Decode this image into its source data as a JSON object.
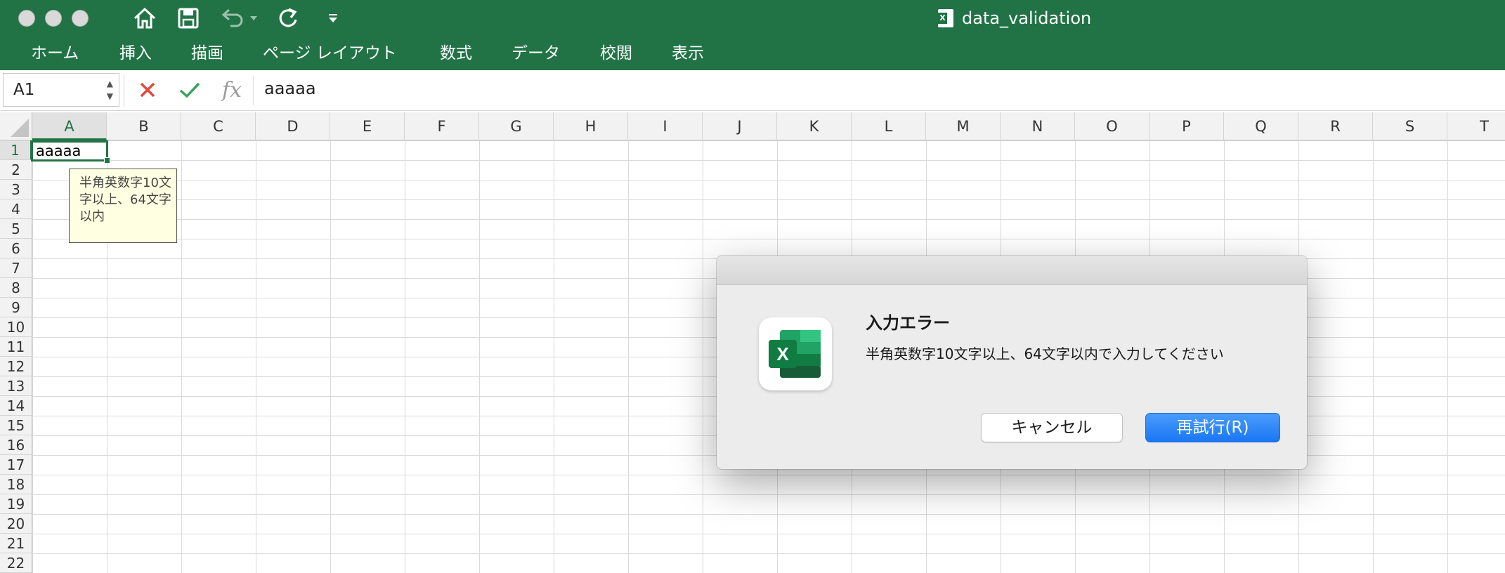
{
  "window": {
    "title": "data_validation"
  },
  "ribbon": {
    "tabs": [
      "ホーム",
      "挿入",
      "描画",
      "ページ レイアウト",
      "数式",
      "データ",
      "校閲",
      "表示"
    ]
  },
  "formula_bar": {
    "name_box": "A1",
    "fx_label": "fx",
    "formula": "aaaaa"
  },
  "sheet": {
    "columns": [
      "A",
      "B",
      "C",
      "D",
      "E",
      "F",
      "G",
      "H",
      "I",
      "J",
      "K",
      "L",
      "M",
      "N",
      "O",
      "P",
      "Q",
      "R",
      "S",
      "T"
    ],
    "rows": [
      "1",
      "2",
      "3",
      "4",
      "5",
      "6",
      "7",
      "8",
      "9",
      "10",
      "11",
      "12",
      "13",
      "14",
      "15",
      "16",
      "17",
      "18",
      "19",
      "20",
      "21",
      "22"
    ],
    "selected_cell_value": "aaaaa",
    "input_message": "半角英数字10文字以上、64文字以内"
  },
  "dialog": {
    "title": "入力エラー",
    "message": "半角英数字10文字以上、64文字以内で入力してください",
    "cancel_label": "キャンセル",
    "retry_label": "再試行(R)",
    "app_icon_letter": "X"
  },
  "colors": {
    "excel_green": "#217346",
    "primary_button": "#1a76f2"
  }
}
